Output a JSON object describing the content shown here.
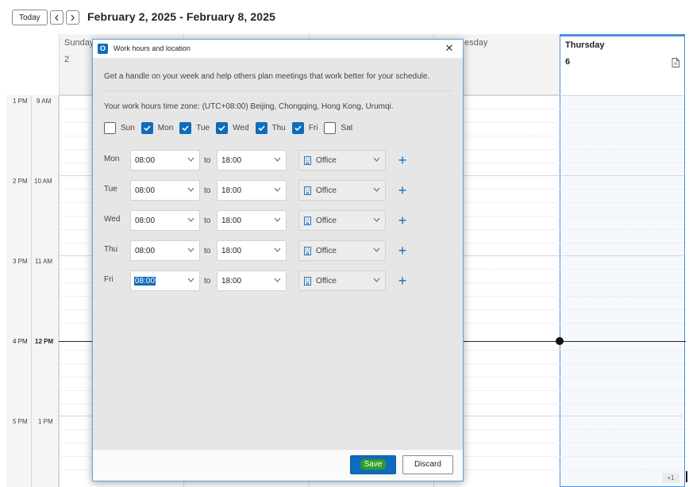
{
  "toolbar": {
    "today_label": "Today",
    "prev_icon": "chevron-left-icon",
    "next_icon": "chevron-right-icon",
    "date_range": "February 2, 2025 - February 8, 2025"
  },
  "calendar": {
    "days": [
      {
        "name": "Sunday",
        "number": "2"
      },
      {
        "name": "",
        "number": ""
      },
      {
        "name": "",
        "number": ""
      },
      {
        "name": "esday",
        "number": ""
      },
      {
        "name": "Thursday",
        "number": "6"
      }
    ],
    "time_rows": [
      {
        "primary": "1 PM",
        "secondary": "9 AM"
      },
      {
        "primary": "2 PM",
        "secondary": "10 AM"
      },
      {
        "primary": "3 PM",
        "secondary": "11 AM"
      },
      {
        "primary": "4 PM",
        "secondary": "12 PM"
      },
      {
        "primary": "5 PM",
        "secondary": "1 PM"
      }
    ],
    "overflow_badge": "+1",
    "accent_color": "#0f6cbd"
  },
  "dialog": {
    "title": "Work hours and location",
    "close_label": "✕",
    "intro": "Get a handle on your week and help others plan meetings that work better for your schedule.",
    "timezone_text": "Your work hours time zone: (UTC+08:00) Beijing, Chongqing, Hong Kong, Urumqi.",
    "weekdays": [
      {
        "label": "Sun",
        "checked": false
      },
      {
        "label": "Mon",
        "checked": true
      },
      {
        "label": "Tue",
        "checked": true
      },
      {
        "label": "Wed",
        "checked": true
      },
      {
        "label": "Thu",
        "checked": true
      },
      {
        "label": "Fri",
        "checked": true
      },
      {
        "label": "Sat",
        "checked": false
      }
    ],
    "to_label": "to",
    "hours": [
      {
        "day": "Mon",
        "start": "08:00",
        "end": "18:00",
        "location": "Office"
      },
      {
        "day": "Tue",
        "start": "08:00",
        "end": "18:00",
        "location": "Office"
      },
      {
        "day": "Wed",
        "start": "08:00",
        "end": "18:00",
        "location": "Office"
      },
      {
        "day": "Thu",
        "start": "08:00",
        "end": "18:00",
        "location": "Office"
      },
      {
        "day": "Fri",
        "start": "08:00",
        "end": "18:00",
        "location": "Office"
      }
    ],
    "add_label": "+",
    "save_label": "Save",
    "discard_label": "Discard"
  }
}
